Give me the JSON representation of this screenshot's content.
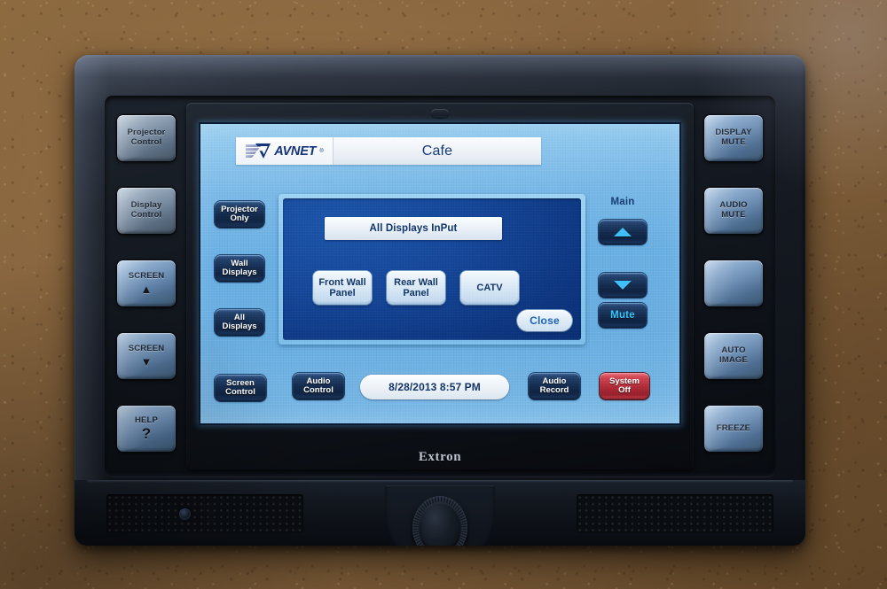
{
  "device": {
    "brand": "Extron",
    "ir_sensor": "ir-window"
  },
  "hard_buttons": {
    "left": [
      {
        "id": "projector-control",
        "line1": "Projector",
        "line2": "Control",
        "glyph": "",
        "style": "darkish"
      },
      {
        "id": "display-control",
        "line1": "Display",
        "line2": "Control",
        "glyph": "",
        "style": "darkish"
      },
      {
        "id": "screen-up",
        "line1": "SCREEN",
        "line2": "",
        "glyph": "▲",
        "style": "bluish"
      },
      {
        "id": "screen-down",
        "line1": "SCREEN",
        "line2": "",
        "glyph": "▼",
        "style": "bluish"
      },
      {
        "id": "help",
        "line1": "HELP",
        "line2": "",
        "glyph": "?",
        "style": "bluish"
      }
    ],
    "right": [
      {
        "id": "display-mute",
        "line1": "DISPLAY",
        "line2": "MUTE",
        "glyph": "",
        "style": "bluish"
      },
      {
        "id": "audio-mute",
        "line1": "AUDIO",
        "line2": "MUTE",
        "glyph": "",
        "style": "bluish"
      },
      {
        "id": "blank",
        "line1": "",
        "line2": "",
        "glyph": "",
        "style": "bluish"
      },
      {
        "id": "auto-image",
        "line1": "AUTO",
        "line2": "IMAGE",
        "glyph": "",
        "style": "bluish"
      },
      {
        "id": "freeze",
        "line1": "FREEZE",
        "line2": "",
        "glyph": "",
        "style": "bluish"
      }
    ]
  },
  "screen": {
    "titlebar": {
      "logo_text": "AVNET",
      "logo_reg": "®",
      "room_title": "Cafe"
    },
    "left_buttons": [
      {
        "id": "projector-only",
        "line1": "Projector",
        "line2": "Only"
      },
      {
        "id": "wall-displays",
        "line1": "Wall",
        "line2": "Displays"
      },
      {
        "id": "all-displays",
        "line1": "All",
        "line2": "Displays"
      }
    ],
    "volume": {
      "label": "Main",
      "up_icon": "triangle-up-icon",
      "down_icon": "triangle-down-icon",
      "mute_label": "Mute"
    },
    "dialog": {
      "header": "All Displays InPut",
      "sources": [
        {
          "id": "front-wall-panel",
          "line1": "Front Wall",
          "line2": "Panel"
        },
        {
          "id": "rear-wall-panel",
          "line1": "Rear Wall",
          "line2": "Panel"
        },
        {
          "id": "catv",
          "line1": "CATV",
          "line2": ""
        }
      ],
      "close_label": "Close"
    },
    "bottom_bar": {
      "screen_control": {
        "line1": "Screen",
        "line2": "Control"
      },
      "audio_control": {
        "line1": "Audio",
        "line2": "Control"
      },
      "datetime": "8/28/2013 8:57 PM",
      "audio_record": {
        "line1": "Audio",
        "line2": "Record"
      },
      "system_off": {
        "line1": "System",
        "line2": "Off"
      }
    }
  },
  "colors": {
    "wall": "#8a6a42",
    "bezel": "#141820",
    "lcd_bg": "#6aaee0",
    "dialog_bg": "#17489a",
    "soft_button": "#142b4d",
    "accent_cyan": "#3fbff7",
    "danger_red": "#ae2b38",
    "avnet_blue": "#15347a"
  }
}
